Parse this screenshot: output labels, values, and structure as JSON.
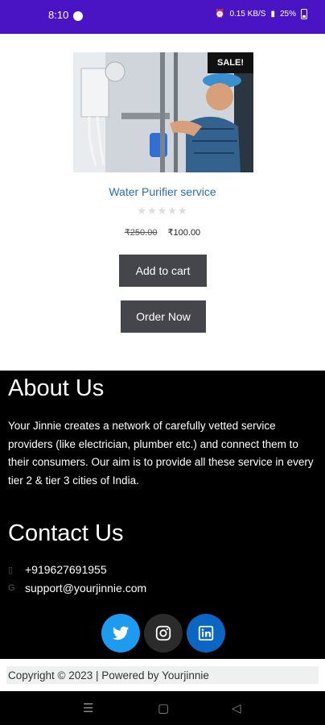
{
  "status_bar": {
    "time": "8:10",
    "right_text": "0.15 KB/S",
    "battery": "25%"
  },
  "product": {
    "badge": "SALE!",
    "title": "Water Purifier service",
    "rating_stars": "★★★★★",
    "old_price": "₹250.00",
    "new_price": "₹100.00",
    "add_to_cart_label": "Add to cart",
    "order_now_label": "Order Now"
  },
  "footer": {
    "about_heading": "About Us",
    "about_text": "Your Jinnie creates a network of carefully vetted service providers (like electrician, plumber etc.) and connect them to their consumers. Our aim is to provide all these service in every tier 2 & tier 3 cities of India.",
    "contact_heading": "Contact Us",
    "phone": "+919627691955",
    "email": "support@yourjinnie.com",
    "social": [
      "twitter-icon",
      "instagram-icon",
      "linkedin-icon"
    ],
    "copyright": "Copyright © 2023 | Powered by Yourjinnie"
  },
  "colors": {
    "status_bar": "#4a14c4",
    "title_link": "#2a6db0",
    "button": "#45464c",
    "twitter": "#1d9bf0",
    "instagram": "#2b2b2b",
    "linkedin": "#0a66c2"
  }
}
